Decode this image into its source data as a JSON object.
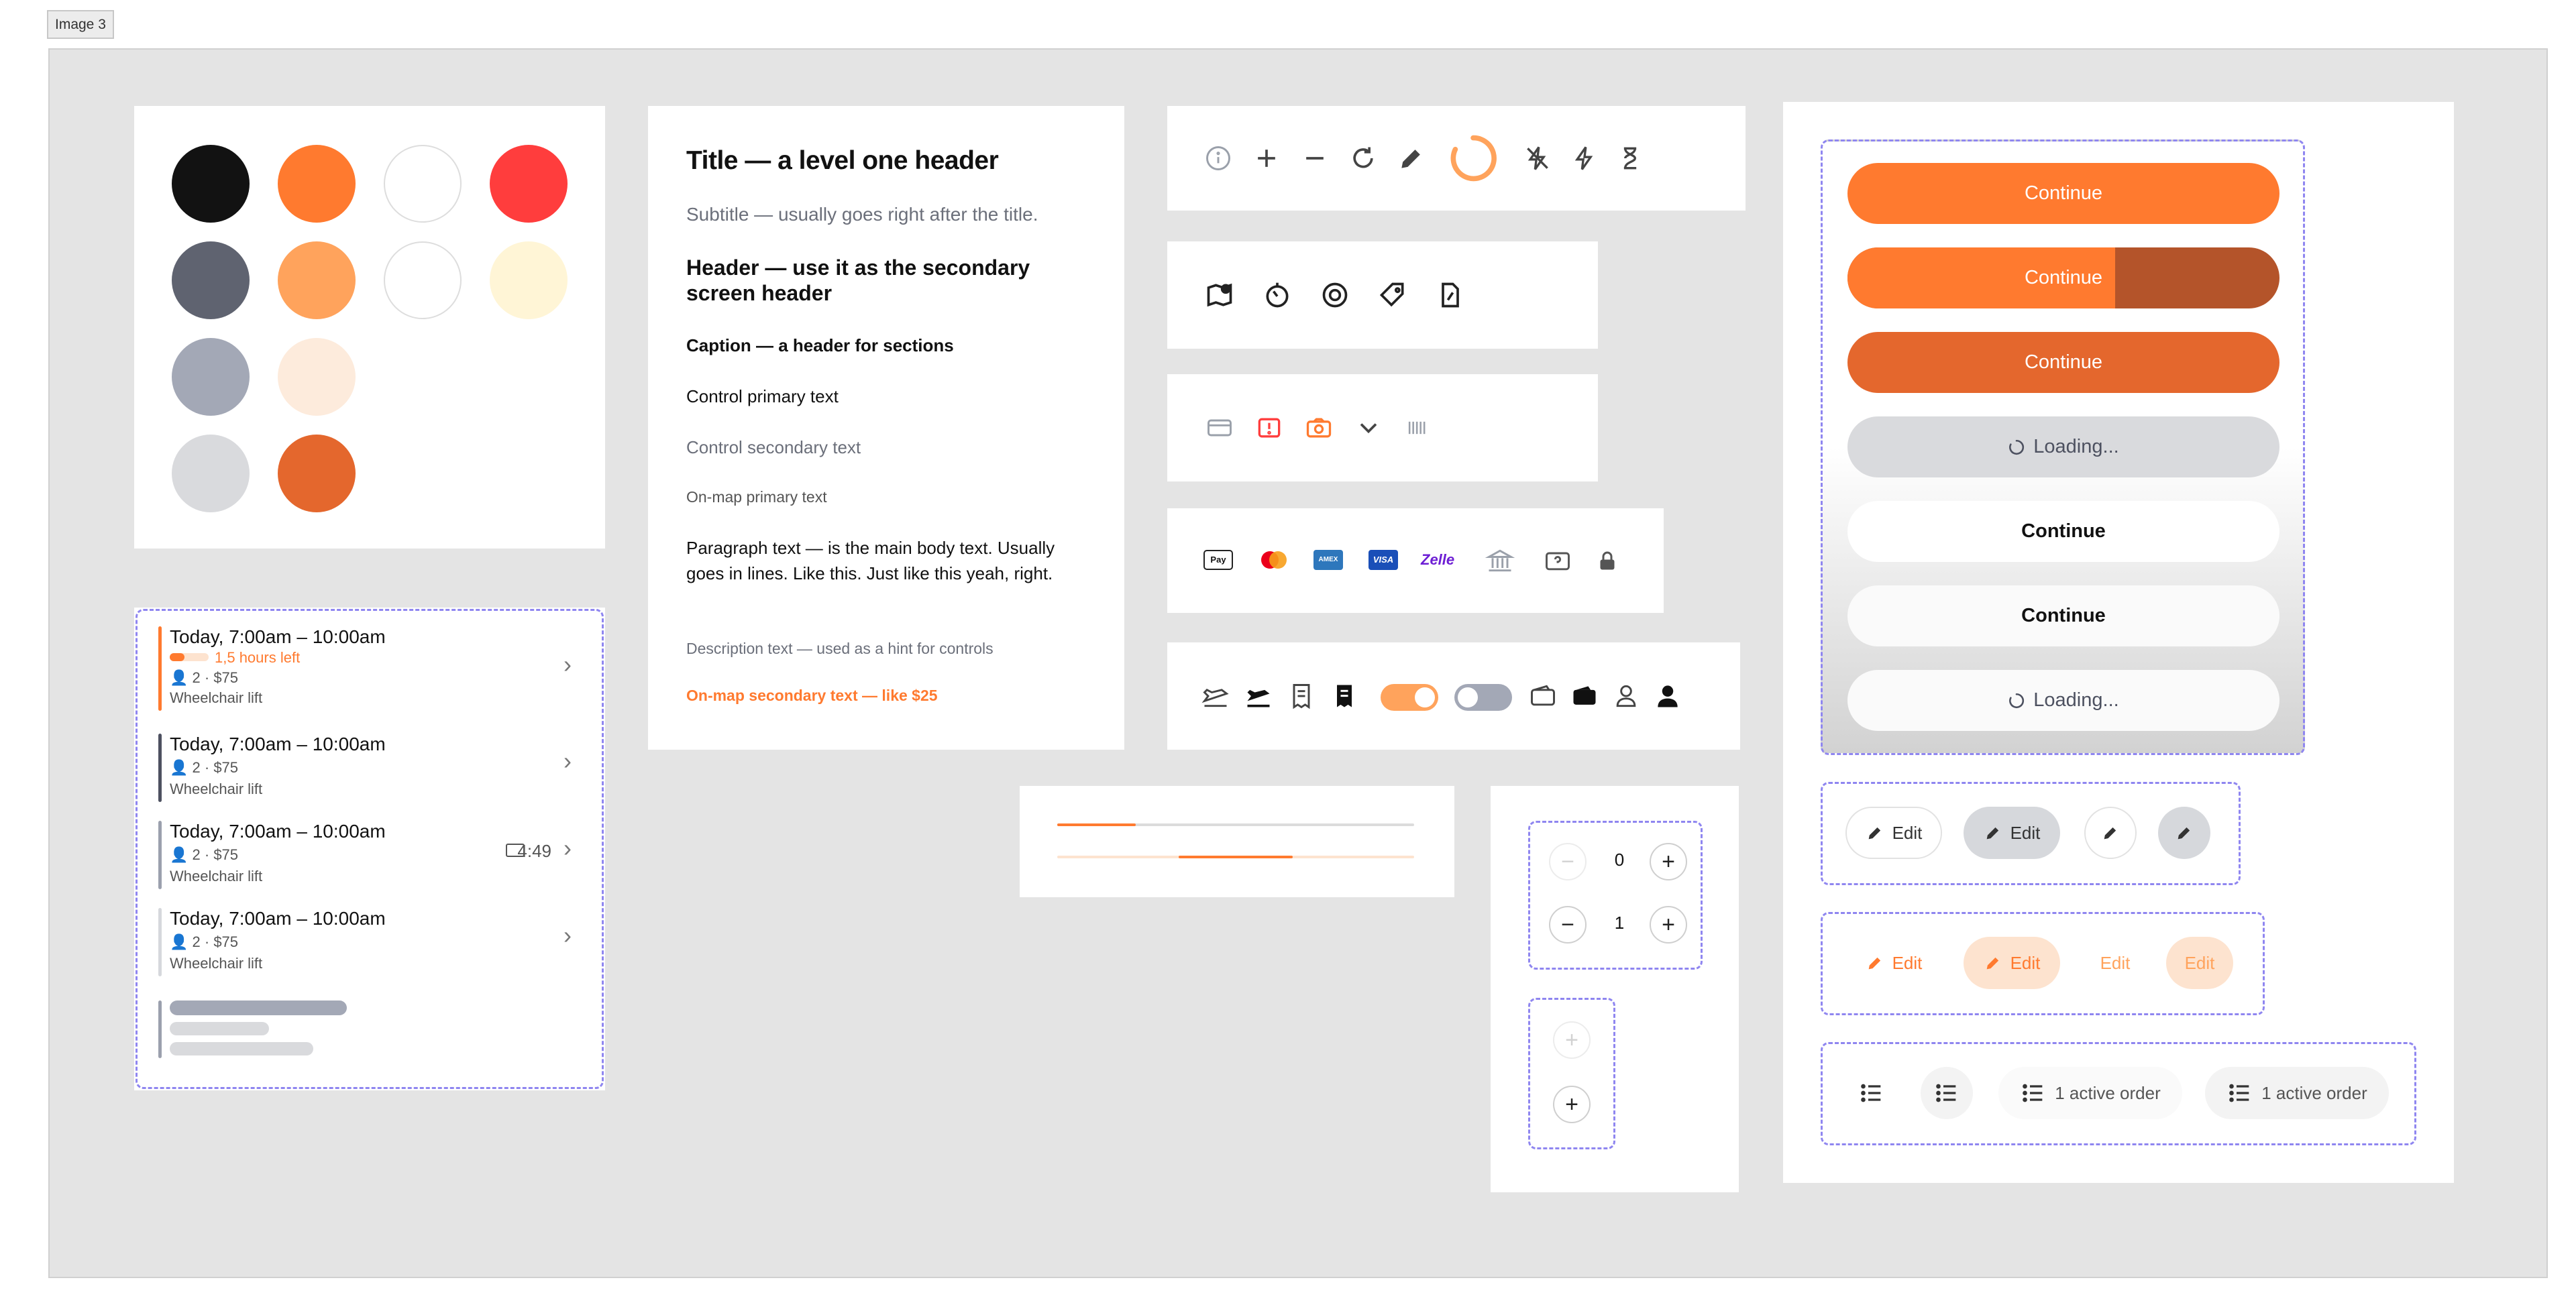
{
  "frame_label": "Image 3",
  "colors": {
    "palette": [
      [
        "#121212",
        "#ff7a2f",
        "#ffffff",
        "#ff3d3d"
      ],
      [
        "#5f6370",
        "#ffa35c",
        "#ffffff",
        "#fff5d6"
      ],
      [
        "#a3a8b6",
        "#fdebdc"
      ],
      [
        "#d9dadd",
        "#e4672d"
      ]
    ],
    "accent": "#ff7a2f",
    "accent_dark": "#b4542a",
    "dashed_outline": "#8f86f0"
  },
  "typography": {
    "title": "Title — a level one header",
    "subtitle": "Subtitle — usually goes right after the title.",
    "header": "Header — use it as the secondary screen header",
    "caption": "Caption — a header for sections",
    "control_primary": "Control primary text",
    "control_secondary": "Control secondary text",
    "onmap_primary": "On-map primary text",
    "paragraph": "Paragraph text — is the main body text. Usually goes in lines. Like this. Just like this yeah, right.",
    "description": "Description text — used as a hint for controls",
    "onmap_secondary": "On-map secondary text — like $25"
  },
  "rides": [
    {
      "time": "Today, 7:00am – 10:00am",
      "warning": "1,5 hours left",
      "meta": "2 · $75",
      "feature": "Wheelchair lift",
      "timer": "",
      "bar_color": "#ff7a2f"
    },
    {
      "time": "Today, 7:00am – 10:00am",
      "warning": "",
      "meta": "2 · $75",
      "feature": "Wheelchair lift",
      "timer": "",
      "bar_color": "#4d5160"
    },
    {
      "time": "Today, 7:00am – 10:00am",
      "warning": "",
      "meta": "2 · $75",
      "feature": "Wheelchair lift",
      "timer": "4:49",
      "bar_color": "#9ba0ad"
    },
    {
      "time": "Today, 7:00am – 10:00am",
      "warning": "",
      "meta": "2 · $75",
      "feature": "Wheelchair lift",
      "timer": "",
      "bar_color": "#d6d8dc"
    }
  ],
  "icon_rows": {
    "row1": [
      "info-icon",
      "plus-icon",
      "minus-icon",
      "refresh-icon",
      "pencil-icon",
      "spinner-icon",
      "flash-off-icon",
      "flash-icon",
      "hourglass-icon"
    ],
    "row2": [
      "map-pin-icon",
      "clock-icon",
      "lifebuoy-icon",
      "tag-icon",
      "document-dollar-icon"
    ],
    "row3": [
      "card-icon",
      "alert-square-icon",
      "camera-icon",
      "chevron-down-icon",
      "barcode-icon"
    ],
    "row4": [
      "apple-pay-icon",
      "mastercard-icon",
      "amex-icon",
      "visa-icon",
      "zelle-icon",
      "bank-icon",
      "wallet-question-icon",
      "lock-icon"
    ],
    "row5": [
      "plane-outline-icon",
      "plane-filled-icon",
      "receipt-outline-icon",
      "receipt-filled-icon",
      "toggle-on",
      "toggle-off",
      "wallet-outline-icon",
      "wallet-filled-icon",
      "user-outline-icon",
      "user-filled-icon"
    ]
  },
  "payment_labels": {
    "apple_pay": "Pay",
    "amex": "AMEX",
    "visa": "VISA",
    "zelle": "Zelle"
  },
  "progress": {
    "line1_fraction": 0.22,
    "line2_start": 0.34,
    "line2_end": 0.66
  },
  "steppers": [
    {
      "value": "0"
    },
    {
      "value": "1"
    }
  ],
  "buttons": {
    "primary": "Continue",
    "progress_fraction": 0.62,
    "loading": "Loading...",
    "white": "Continue",
    "white2": "Continue",
    "loading_white": "Loading..."
  },
  "edit_pills": {
    "label": "Edit"
  },
  "orders": {
    "label": "1 active order"
  }
}
